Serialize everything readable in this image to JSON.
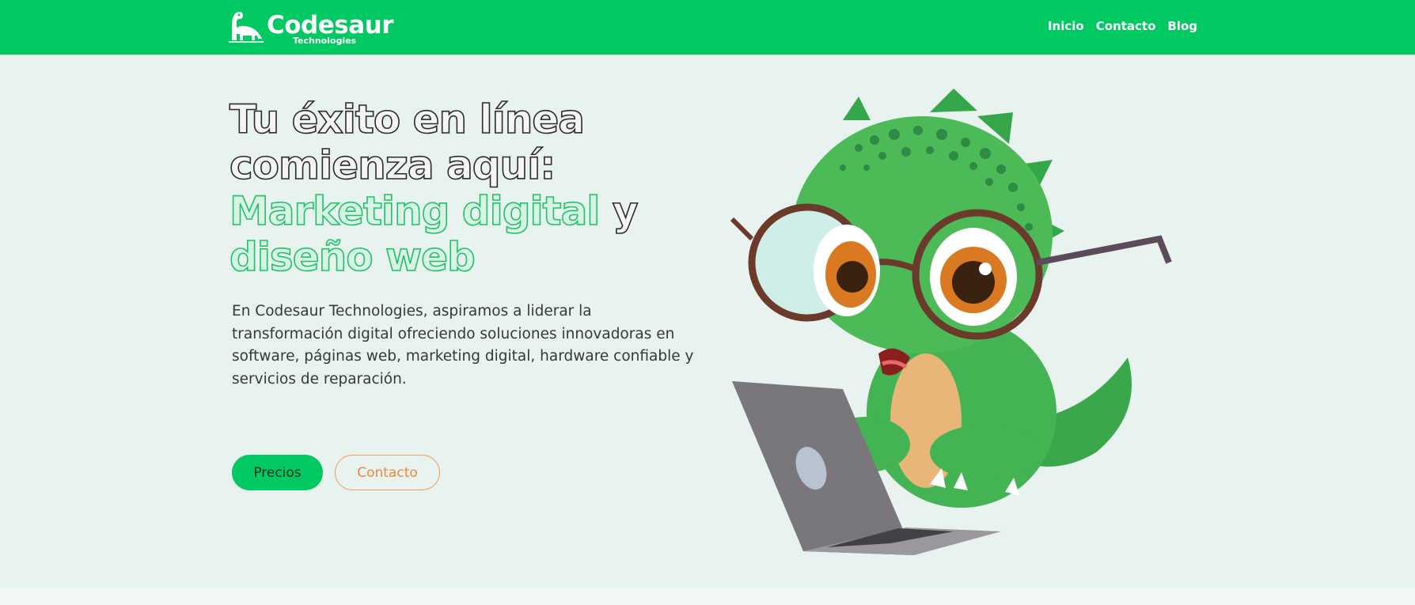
{
  "brand": {
    "name": "Codesaur",
    "tagline": "Technologies",
    "color": "#00c962"
  },
  "nav": {
    "links": [
      {
        "label": "Inicio"
      },
      {
        "label": "Contacto"
      },
      {
        "label": "Blog"
      }
    ]
  },
  "hero": {
    "headline_dark": "Tu éxito en línea comienza aquí:",
    "headline_green": "Marketing digital",
    "headline_connector": " y ",
    "headline_green2": "diseño web",
    "description": "En Codesaur Technologies, aspiramos a liderar la transformación digital ofreciendo soluciones innovadoras en software, páginas web, marketing digital, hardware confiable y servicios de reparación.",
    "primary_button": "Precios",
    "secondary_button": "Contacto",
    "illustration": "dinosaur-with-glasses-and-laptop"
  },
  "colors": {
    "nav_bg": "#00c962",
    "hero_bg": "#e8f2ee",
    "accent_orange": "#e8893f"
  }
}
